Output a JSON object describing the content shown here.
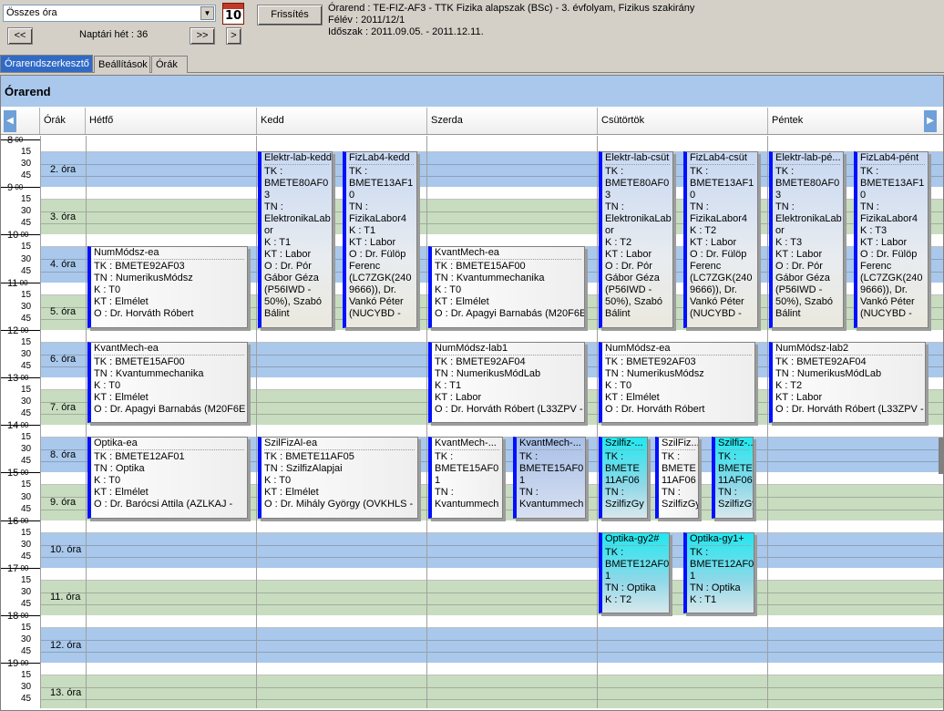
{
  "toolbar": {
    "select_value": "Összes óra",
    "calendar_icon_num": "10",
    "refresh_label": "Frissítés",
    "prev_label": "<<",
    "week_label": "Naptári hét : 36",
    "next_label": ">>",
    "next2_label": ">"
  },
  "info": {
    "line1": "Órarend : TE-FIZ-AF3 - TTK Fizika alapszak (BSc) - 3. évfolyam, Fizikus szakirány",
    "line2": "Félév : 2011/12/1",
    "line3": "Időszak : 2011.09.05. - 2011.12.11."
  },
  "tabs": [
    "Órarendszerkesztő",
    "Beállítások",
    "Órák"
  ],
  "section_title": "Órarend",
  "columns": {
    "hours": "Órák",
    "mon": "Hétfő",
    "tue": "Kedd",
    "wed": "Szerda",
    "thu": "Csütörtök",
    "fri": "Péntek"
  },
  "times": [
    "8 00",
    "9 00",
    "10 00",
    "11 00",
    "12 00",
    "13 00",
    "14 00",
    "15 00",
    "16 00",
    "17 00",
    "18 00",
    "19 00"
  ],
  "minutes": [
    "15",
    "30",
    "45"
  ],
  "periods": [
    "2. óra",
    "3. óra",
    "4. óra",
    "5. óra",
    "6. óra",
    "7. óra",
    "8. óra",
    "9. óra",
    "10. óra",
    "11. óra",
    "12. óra",
    "13. óra"
  ],
  "events": [
    {
      "title": "NumMódsz-ea",
      "lines": [
        "TK : BMETE92AF03",
        "TN : NumerikusMódsz",
        "K : T0",
        "KT : Elmélet",
        "O : Dr. Horváth Róbert"
      ]
    },
    {
      "title": "KvantMech-ea",
      "lines": [
        "TK : BMETE15AF00",
        "TN : Kvantummechanika",
        "K : T0",
        "KT : Elmélet",
        "O : Dr. Apagyi Barnabás (M20F6E"
      ]
    },
    {
      "title": "Optika-ea",
      "lines": [
        "TK : BMETE12AF01",
        "TN : Optika",
        "K : T0",
        "KT : Elmélet",
        "O : Dr. Barócsi Attila (AZLKAJ -"
      ]
    },
    {
      "title": "Elektr-lab-kedd",
      "lines": [
        "TK :",
        "BMETE80AF0",
        "3",
        "TN :",
        "ElektronikaLab",
        "or",
        "K : T1",
        "KT : Labor",
        "O : Dr. Pór",
        "Gábor Géza",
        "(P56IWD -",
        "50%), Szabó",
        "Bálint"
      ]
    },
    {
      "title": "FizLab4-kedd",
      "lines": [
        "TK :",
        "BMETE13AF1",
        "0",
        "TN :",
        "FizikaLabor4",
        "K : T1",
        "KT : Labor",
        "O : Dr. Fülöp",
        "Ferenc",
        "(LC7ZGK(240",
        "9666)), Dr.",
        "Vankó Péter",
        "(NUCYBD -"
      ]
    },
    {
      "title": "SzilFizAl-ea",
      "lines": [
        "TK : BMETE11AF05",
        "TN : SzilfizAlapjai",
        "K : T0",
        "KT : Elmélet",
        "O : Dr. Mihály György (OVKHLS -"
      ]
    },
    {
      "title": "KvantMech-ea",
      "lines": [
        "TK : BMETE15AF00",
        "TN : Kvantummechanika",
        "K : T0",
        "KT : Elmélet",
        "O : Dr. Apagyi Barnabás (M20F6E"
      ]
    },
    {
      "title": "NumMódsz-lab1",
      "lines": [
        "TK : BMETE92AF04",
        "TN : NumerikusMódLab",
        "K : T1",
        "KT : Labor",
        "O : Dr. Horváth Róbert (L33ZPV -"
      ]
    },
    {
      "title": "KvantMech-...",
      "lines": [
        "TK :",
        "BMETE15AF0",
        "1",
        "TN :",
        "Kvantummech"
      ]
    },
    {
      "title": "KvantMech-...",
      "lines": [
        "TK :",
        "BMETE15AF0",
        "1",
        "TN :",
        "Kvantummech"
      ]
    },
    {
      "title": "Elektr-lab-csüt",
      "lines": [
        "TK :",
        "BMETE80AF0",
        "3",
        "TN :",
        "ElektronikaLab",
        "or",
        "K : T2",
        "KT : Labor",
        "O : Dr. Pór",
        "Gábor Géza",
        "(P56IWD -",
        "50%), Szabó",
        "Bálint"
      ]
    },
    {
      "title": "FizLab4-csüt",
      "lines": [
        "TK :",
        "BMETE13AF1",
        "0",
        "TN :",
        "FizikaLabor4",
        "K : T2",
        "KT : Labor",
        "O : Dr. Fülöp",
        "Ferenc",
        "(LC7ZGK(240",
        "9666)), Dr.",
        "Vankó Péter",
        "(NUCYBD -"
      ]
    },
    {
      "title": "NumMódsz-ea",
      "lines": [
        "TK : BMETE92AF03",
        "TN : NumerikusMódsz",
        "K : T0",
        "KT : Elmélet",
        "O : Dr. Horváth Róbert"
      ]
    },
    {
      "title": "Szilfiz-...",
      "lines": [
        "TK :",
        "BMETE",
        "11AF06",
        "TN :",
        "SzilfizGy"
      ]
    },
    {
      "title": "SzilFiz...",
      "lines": [
        "TK :",
        "BMETE",
        "11AF06",
        "TN :",
        "SzilfizGy"
      ]
    },
    {
      "title": "Szilfiz-...",
      "lines": [
        "TK :",
        "BMETE",
        "11AF06",
        "TN :",
        "SzilfizGy"
      ]
    },
    {
      "title": "Optika-gy2#",
      "lines": [
        "TK :",
        "BMETE12AF0",
        "1",
        "TN : Optika",
        "K : T2"
      ]
    },
    {
      "title": "Optika-gy1+",
      "lines": [
        "TK :",
        "BMETE12AF0",
        "1",
        "TN : Optika",
        "K : T1"
      ]
    },
    {
      "title": "Elektr-lab-pé...",
      "lines": [
        "TK :",
        "BMETE80AF0",
        "3",
        "TN :",
        "ElektronikaLab",
        "or",
        "K : T3",
        "KT : Labor",
        "O : Dr. Pór",
        "Gábor Géza",
        "(P56IWD -",
        "50%), Szabó",
        "Bálint"
      ]
    },
    {
      "title": "FizLab4-pént",
      "lines": [
        "TK :",
        "BMETE13AF1",
        "0",
        "TN :",
        "FizikaLabor4",
        "K : T3",
        "KT : Labor",
        "O : Dr. Fülöp",
        "Ferenc",
        "(LC7ZGK(240",
        "9666)), Dr.",
        "Vankó Péter",
        "(NUCYBD -"
      ]
    },
    {
      "title": "NumMódsz-lab2",
      "lines": [
        "TK : BMETE92AF04",
        "TN : NumerikusMódLab",
        "K : T2",
        "KT : Labor",
        "O : Dr. Horváth Róbert (L33ZPV -"
      ]
    }
  ]
}
